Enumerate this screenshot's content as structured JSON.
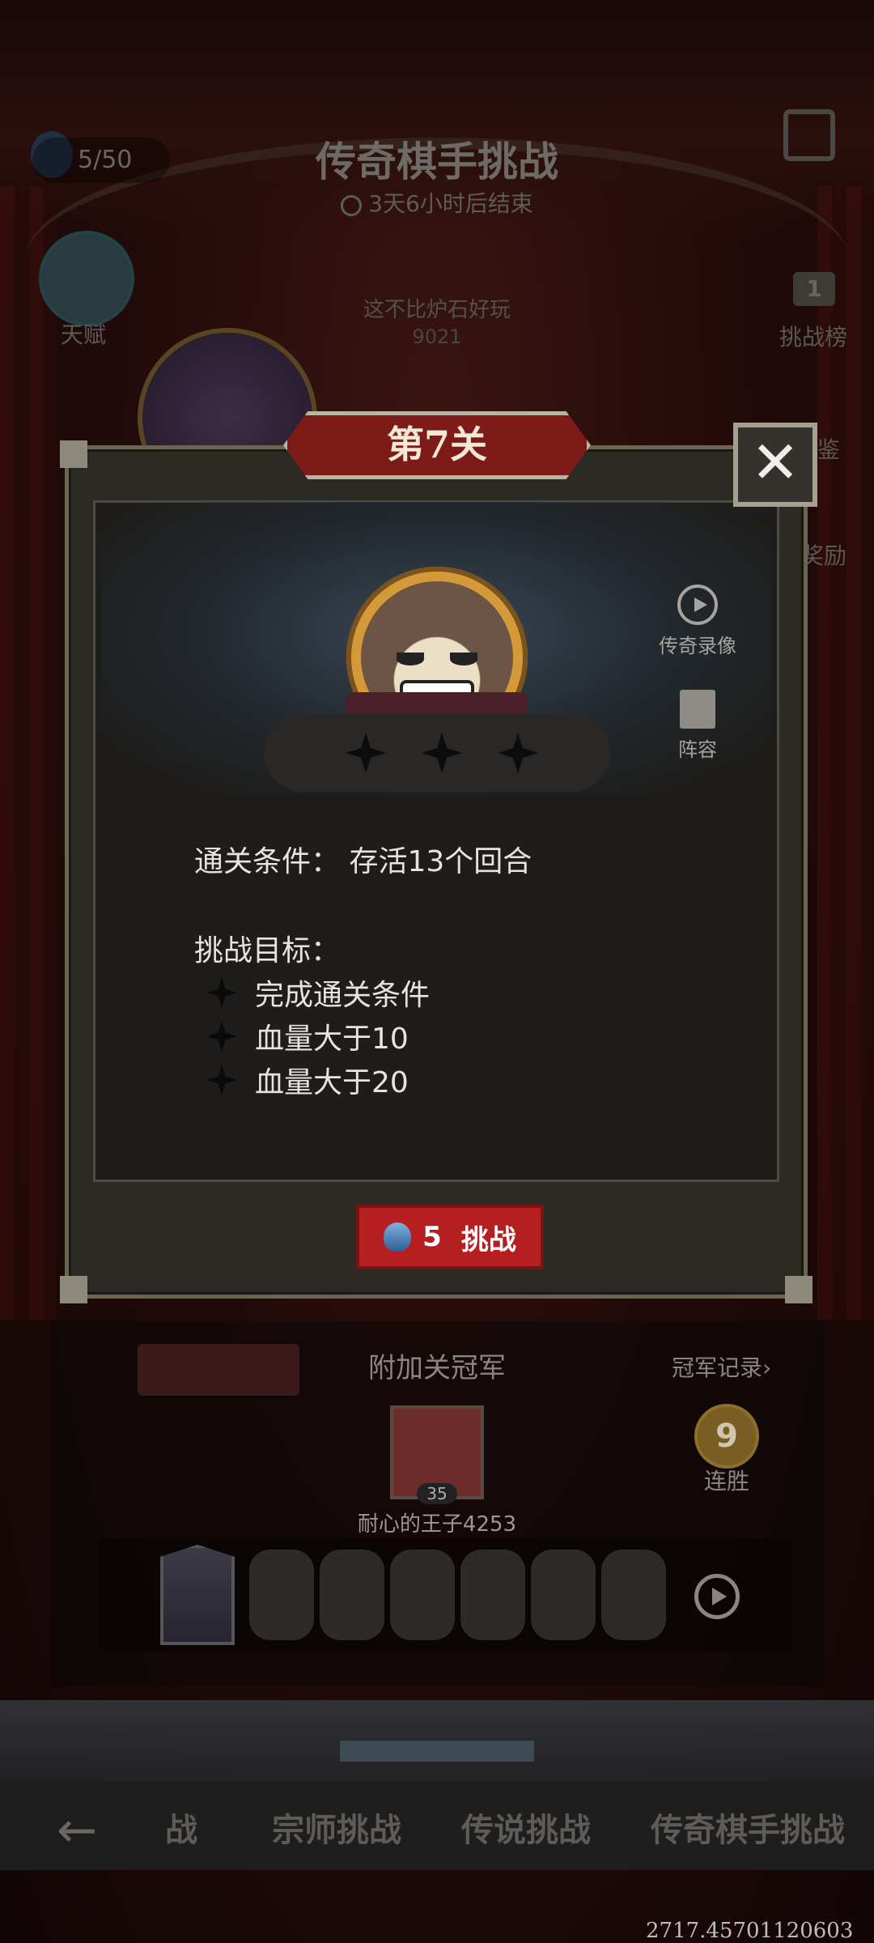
{
  "header": {
    "title": "传奇棋手挑战",
    "countdown": "3天6小时后结束",
    "stamina": "5/50"
  },
  "background": {
    "talent_label": "天赋",
    "leaderboard_rank": "1",
    "leaderboard_label": "挑战榜",
    "side_label_1": "鉴",
    "side_label_2": "奖励",
    "opponent_text": "这不比炉石好玩",
    "opponent_score": "9021"
  },
  "dialog": {
    "title": "第7关",
    "close_label": "✕",
    "side_buttons": {
      "replay_label": "传奇录像",
      "lineup_label": "阵容"
    },
    "stars_count": 3,
    "condition_label": "通关条件：",
    "condition_value": "存活13个回合",
    "goals_title": "挑战目标：",
    "goals": [
      "完成通关条件",
      "血量大于10",
      "血量大于20"
    ],
    "challenge_cost": "5",
    "challenge_label": "挑战"
  },
  "champion": {
    "section_title": "附加关冠军",
    "record_link": "冠军记录›",
    "level": "35",
    "name": "耐心的王子4253",
    "streak": "9",
    "streak_label": "连胜",
    "empty_slots": 6
  },
  "tabs": [
    "战",
    "宗师挑战",
    "传说挑战",
    "传奇棋手挑战"
  ],
  "footer_coord": "2717.45701120603",
  "colors": {
    "banner_red": "#7c1b17",
    "button_red": "#b61f1f",
    "gold_ring": "#d49a3a"
  }
}
